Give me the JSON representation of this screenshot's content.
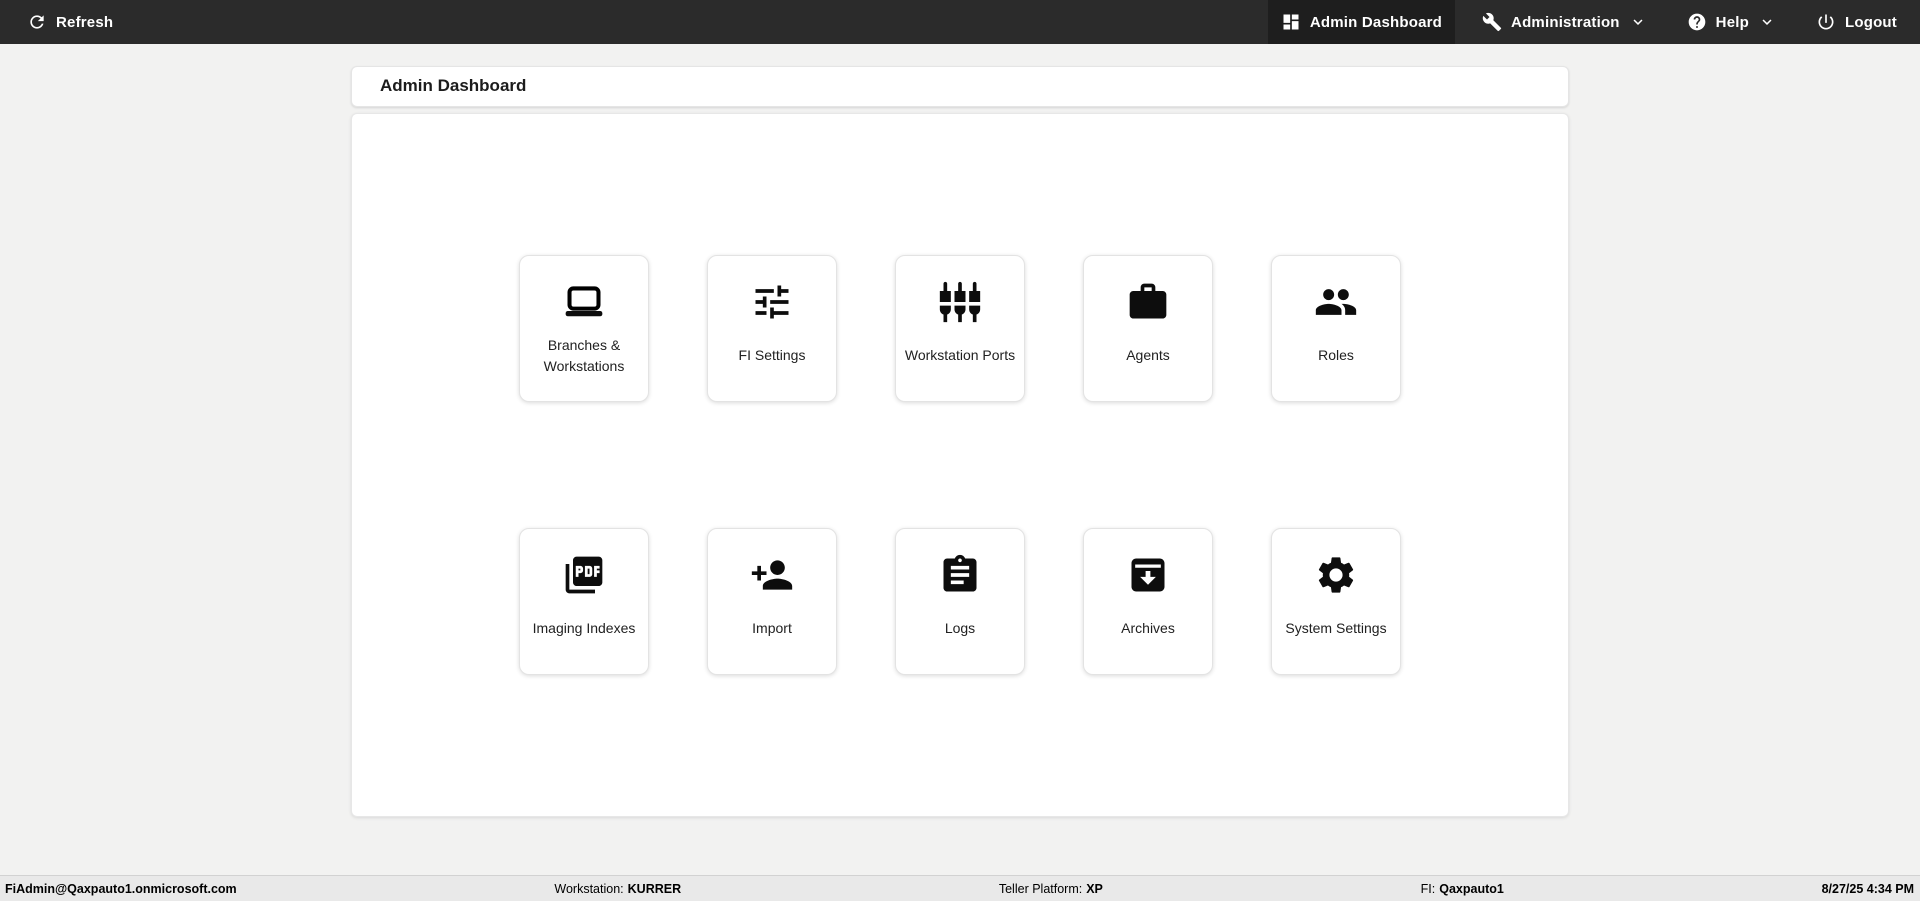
{
  "topbar": {
    "refresh_label": "Refresh",
    "nav_items": [
      {
        "label": "Admin Dashboard",
        "icon": "dashboard-icon",
        "active": true,
        "has_dropdown": false
      },
      {
        "label": "Administration",
        "icon": "wrench-icon",
        "active": false,
        "has_dropdown": true
      },
      {
        "label": "Help",
        "icon": "help-icon",
        "active": false,
        "has_dropdown": true
      },
      {
        "label": "Logout",
        "icon": "power-icon",
        "active": false,
        "has_dropdown": false
      }
    ]
  },
  "page": {
    "title": "Admin Dashboard"
  },
  "tiles": [
    {
      "label": "Branches & Workstations",
      "icon": "laptop"
    },
    {
      "label": "FI Settings",
      "icon": "tune-sliders"
    },
    {
      "label": "Workstation Ports",
      "icon": "component-ports"
    },
    {
      "label": "Agents",
      "icon": "briefcase"
    },
    {
      "label": "Roles",
      "icon": "people"
    },
    {
      "label": "Imaging Indexes",
      "icon": "pdf"
    },
    {
      "label": "Import",
      "icon": "person-add"
    },
    {
      "label": "Logs",
      "icon": "clipboard"
    },
    {
      "label": "Archives",
      "icon": "archive"
    },
    {
      "label": "System Settings",
      "icon": "gear"
    }
  ],
  "footer": {
    "user": "FiAdmin@Qaxpauto1.onmicrosoft.com",
    "workstation_label": "Workstation:",
    "workstation_value": "KURRER",
    "platform_label": "Teller Platform:",
    "platform_value": "XP",
    "fi_label": "FI:",
    "fi_value": "Qaxpauto1",
    "datetime": "8/27/25 4:34 PM"
  },
  "colors": {
    "topbar_bg": "#2b2b2b",
    "topbar_active_bg": "#1e1e1e",
    "page_bg": "#f2f2f1",
    "footer_bg": "#e9e9e9",
    "icon_color": "#0d0d0d"
  }
}
